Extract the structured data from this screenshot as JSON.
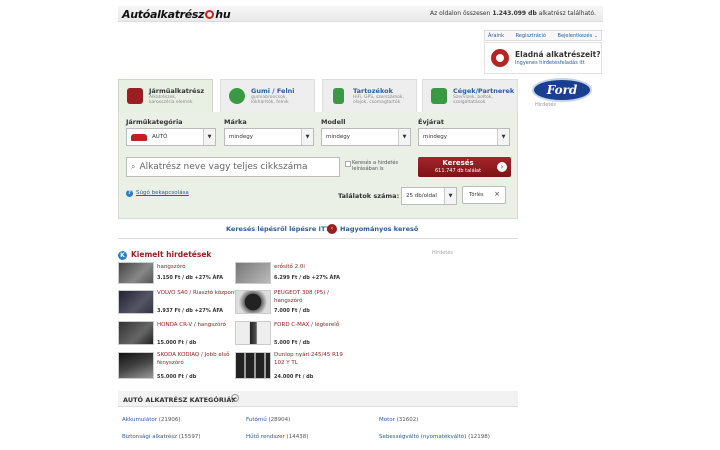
{
  "header": {
    "logo": "Autóalkatrész",
    "logo_suffix": "hu",
    "counter_prefix": "Az oldalon összesen",
    "counter_value": "1.243.099 db",
    "counter_suffix": "alkatrész található."
  },
  "toplinks": [
    "Áraink",
    "Regisztráció",
    "Bejelentkezés"
  ],
  "sell": {
    "title": "Eladná alkatrészeit?",
    "subtitle": "Ingyenes hirdetésfeladás itt"
  },
  "ad": {
    "brand": "Ford",
    "caption": "Hirdetés"
  },
  "tabs": [
    {
      "title": "Járműalkatrész",
      "sub": "Alkatrészek, karosszéria elemek",
      "active": true
    },
    {
      "title": "Gumi / Felni",
      "sub": "gumiabroncsok, lökhárítók, felnik",
      "active": false
    },
    {
      "title": "Tartozékok",
      "sub": "HiFi, GPS, szerszámok, olajok, csomagtartók",
      "active": false
    },
    {
      "title": "Cégek/Partnerek",
      "sub": "Szervizek, boltok, szolgáltatások",
      "active": false
    }
  ],
  "filters": {
    "vehicle_label": "Járműkategória",
    "vehicle_value": "AUTÓ",
    "brand_label": "Márka",
    "brand_value": "mindegy",
    "model_label": "Modell",
    "model_value": "mindegy",
    "year_label": "Évjárat",
    "year_value": "mindegy"
  },
  "search": {
    "placeholder": "Alkatrész neve vagy teljes cikkszáma",
    "in_desc": "Keresés a hirdetés leírásában is",
    "button": "Keresés",
    "button_count": "611.747 db találat",
    "help": "Súgó bekapcsolása",
    "results_label": "Találatok száma:",
    "results_value": "25 db/oldal",
    "clear": "Törlés"
  },
  "steps": {
    "step": "Keresés lépésről lépésre ITT",
    "classic": "Hagyományos kereső"
  },
  "featured": {
    "title": "Kiemelt hirdetések",
    "ad_label": "Hirdetés",
    "items": [
      {
        "name": "hangszóró",
        "price": "3.150 Ft / db +27% ÁFA"
      },
      {
        "name": "erősítő 2.0i",
        "price": "6.299 Ft / db +27% ÁFA"
      },
      {
        "name": "VOLVO S40 / Riasztó központ",
        "price": "3.937 Ft / db +27% ÁFA"
      },
      {
        "name": "PEUGEOT 308 (P5) / hangszóró",
        "price": "7.000 Ft / db"
      },
      {
        "name": "HONDA CR-V / hangszóró",
        "price": "15.000 Ft / db"
      },
      {
        "name": "FORD C-MAX / légterelő",
        "price": "5.000 Ft / db"
      },
      {
        "name": "SKODA KODIAQ / Jobb első fényszóró",
        "price": "55.000 Ft / db"
      },
      {
        "name": "Dunlop nyári 245/45 R19 102 Y TL",
        "price": "24.000 Ft / db"
      }
    ]
  },
  "categories": {
    "title": "AUTÓ ALKATRÉSZ KATEGÓRIÁK",
    "items": [
      {
        "name": "Akkumulátor",
        "count": "(21906)"
      },
      {
        "name": "Futómű",
        "count": "(28904)"
      },
      {
        "name": "Motor",
        "count": "(31602)"
      },
      {
        "name": "Biztonsági alkatrész",
        "count": "(15597)"
      },
      {
        "name": "Hűtő rendszer",
        "count": "(14438)"
      },
      {
        "name": "Sebességváltó (nyomatékváltó)",
        "count": "(12198)"
      }
    ]
  },
  "colors": {
    "accent_red": "#9a1e22",
    "link_blue": "#2a5c9c",
    "panel_green": "#eaf0e6"
  }
}
